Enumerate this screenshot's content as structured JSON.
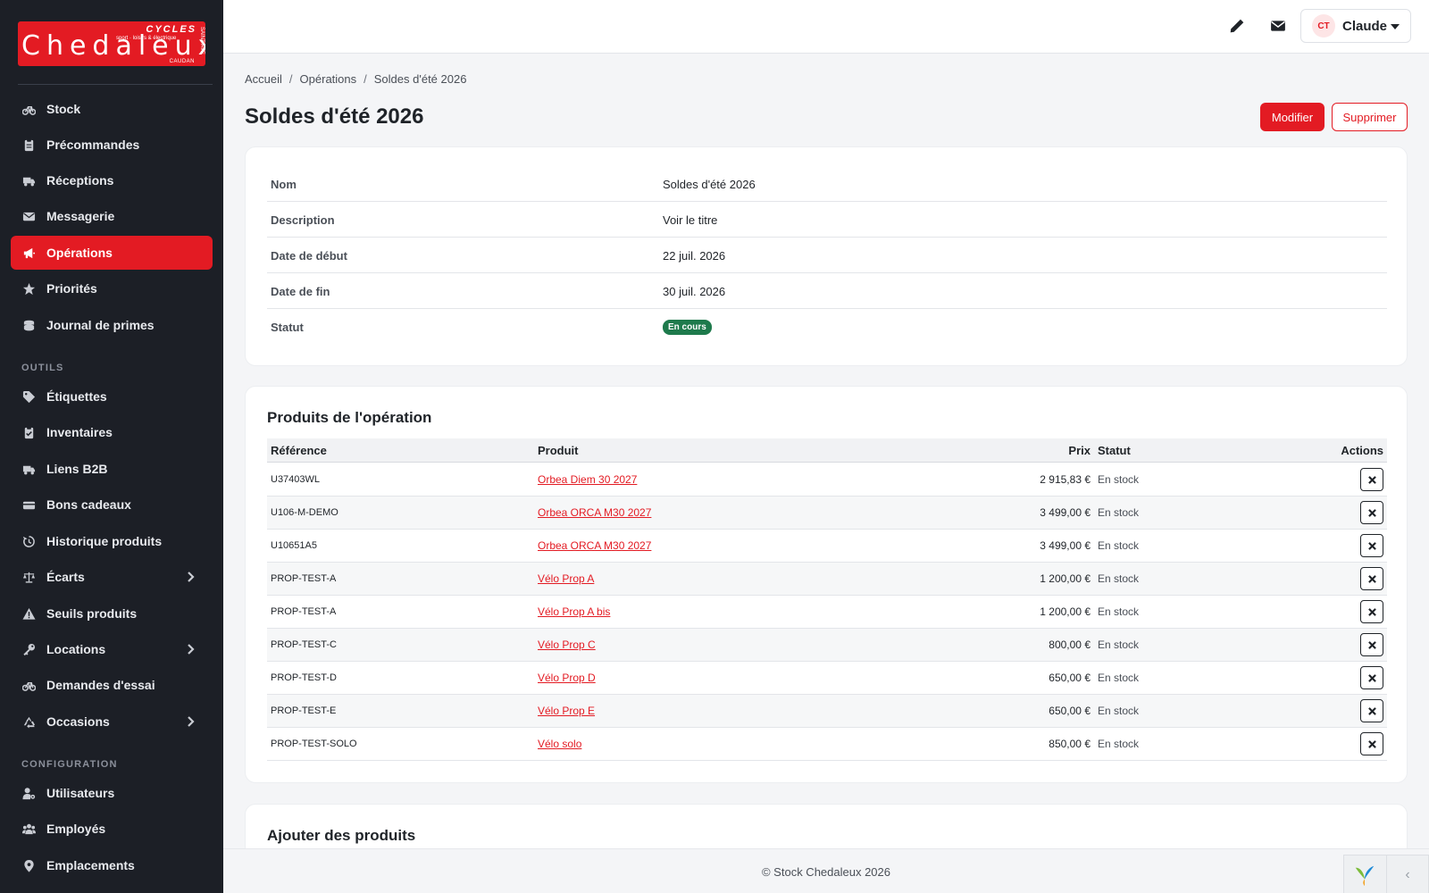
{
  "logo": {
    "word": "Chedaleux",
    "cycles": "CYCLES",
    "tag": "sport · loisirs & électrique",
    "city": "CAUDAN",
    "side": "SAINT-AVÉ"
  },
  "sidebar": {
    "items": [
      {
        "label": "Stock",
        "icon": "bicycle-icon"
      },
      {
        "label": "Précommandes",
        "icon": "clipboard-icon"
      },
      {
        "label": "Réceptions",
        "icon": "truck-icon"
      },
      {
        "label": "Messagerie",
        "icon": "envelope-icon"
      },
      {
        "label": "Opérations",
        "icon": "megaphone-icon",
        "active": true
      },
      {
        "label": "Priorités",
        "icon": "star-icon"
      },
      {
        "label": "Journal de primes",
        "icon": "coins-icon"
      }
    ],
    "tools_label": "OUTILS",
    "tools": [
      {
        "label": "Étiquettes",
        "icon": "tag-icon"
      },
      {
        "label": "Inventaires",
        "icon": "clipboard-check-icon"
      },
      {
        "label": "Liens B2B",
        "icon": "truck-link-icon"
      },
      {
        "label": "Bons cadeaux",
        "icon": "gift-card-icon"
      },
      {
        "label": "Historique produits",
        "icon": "history-icon"
      },
      {
        "label": "Écarts",
        "icon": "scale-icon",
        "expandable": true
      },
      {
        "label": "Seuils produits",
        "icon": "warning-icon"
      },
      {
        "label": "Locations",
        "icon": "key-icon",
        "expandable": true
      },
      {
        "label": "Demandes d'essai",
        "icon": "bicycle-icon"
      },
      {
        "label": "Occasions",
        "icon": "recycle-icon",
        "expandable": true
      }
    ],
    "config_label": "CONFIGURATION",
    "config": [
      {
        "label": "Utilisateurs",
        "icon": "user-gear-icon"
      },
      {
        "label": "Employés",
        "icon": "users-icon"
      },
      {
        "label": "Emplacements",
        "icon": "location-pin-icon"
      }
    ]
  },
  "topbar": {
    "user": {
      "initials": "CT",
      "name": "Claude"
    }
  },
  "breadcrumb": [
    "Accueil",
    "Opérations",
    "Soldes d'été 2026"
  ],
  "breadcrumb_sep": "/",
  "page": {
    "title": "Soldes d'été 2026",
    "edit_label": "Modifier",
    "delete_label": "Supprimer"
  },
  "details": [
    {
      "label": "Nom",
      "value": "Soldes d'été 2026"
    },
    {
      "label": "Description",
      "value": "Voir le titre"
    },
    {
      "label": "Date de début",
      "value": "22 juil. 2026"
    },
    {
      "label": "Date de fin",
      "value": "30 juil. 2026"
    },
    {
      "label": "Statut",
      "value": "En cours",
      "badge_color": "#1e7a4c"
    }
  ],
  "products": {
    "title": "Produits de l'opération",
    "columns": {
      "ref": "Référence",
      "product": "Produit",
      "price": "Prix",
      "status": "Statut",
      "actions": "Actions"
    },
    "rows": [
      {
        "ref": "U37403WL",
        "product": "Orbea Diem 30 2027",
        "price": "2 915,83 €",
        "status": "En stock"
      },
      {
        "ref": "U106-M-DEMO",
        "product": "Orbea ORCA M30 2027",
        "price": "3 499,00 €",
        "status": "En stock"
      },
      {
        "ref": "U10651A5",
        "product": "Orbea ORCA M30 2027",
        "price": "3 499,00 €",
        "status": "En stock"
      },
      {
        "ref": "PROP-TEST-A",
        "product": "Vélo Prop A",
        "price": "1 200,00 €",
        "status": "En stock"
      },
      {
        "ref": "PROP-TEST-A",
        "product": "Vélo Prop A bis",
        "price": "1 200,00 €",
        "status": "En stock"
      },
      {
        "ref": "PROP-TEST-C",
        "product": "Vélo Prop C",
        "price": "800,00 €",
        "status": "En stock"
      },
      {
        "ref": "PROP-TEST-D",
        "product": "Vélo Prop D",
        "price": "650,00 €",
        "status": "En stock"
      },
      {
        "ref": "PROP-TEST-E",
        "product": "Vélo Prop E",
        "price": "650,00 €",
        "status": "En stock"
      },
      {
        "ref": "PROP-TEST-SOLO",
        "product": "Vélo solo",
        "price": "850,00 €",
        "status": "En stock"
      }
    ]
  },
  "add_products": {
    "title": "Ajouter des produits"
  },
  "footer": {
    "text": "© Stock Chedaleux 2026"
  },
  "colors": {
    "accent": "#e31b23",
    "sidebar": "#1c1f26",
    "badge": "#1e7a4c"
  }
}
